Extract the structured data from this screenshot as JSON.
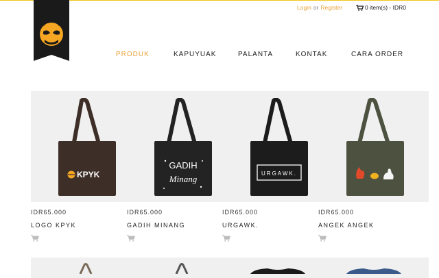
{
  "header": {
    "logo_name": "ant-head-logo",
    "login_label": "Login",
    "or_label": "or",
    "register_label": "Register",
    "cart_label": "0 item(s) - IDR0",
    "accent_color": "#e8a33a"
  },
  "nav": {
    "items": [
      {
        "label": "PRODUK",
        "active": true
      },
      {
        "label": "KAPUYUAK",
        "active": false
      },
      {
        "label": "PALANTA",
        "active": false
      },
      {
        "label": "KONTAK",
        "active": false
      },
      {
        "label": "CARA ORDER",
        "active": false
      }
    ]
  },
  "products": [
    {
      "price": "IDR65.000",
      "name": "LOGO KPYK",
      "bag_print": "KPYK",
      "bag_color": "#3d2f28"
    },
    {
      "price": "IDR65.000",
      "name": "GADIH MINANG",
      "bag_print_line1": "GADIH",
      "bag_print_line2": "Minang",
      "bag_color": "#232323"
    },
    {
      "price": "IDR65.000",
      "name": "URGAWK.",
      "bag_print": "URGAWK.",
      "bag_color": "#1c1c1c"
    },
    {
      "price": "IDR65.000",
      "name": "ANGEK ANGEK",
      "bag_color": "#4c5140"
    }
  ]
}
